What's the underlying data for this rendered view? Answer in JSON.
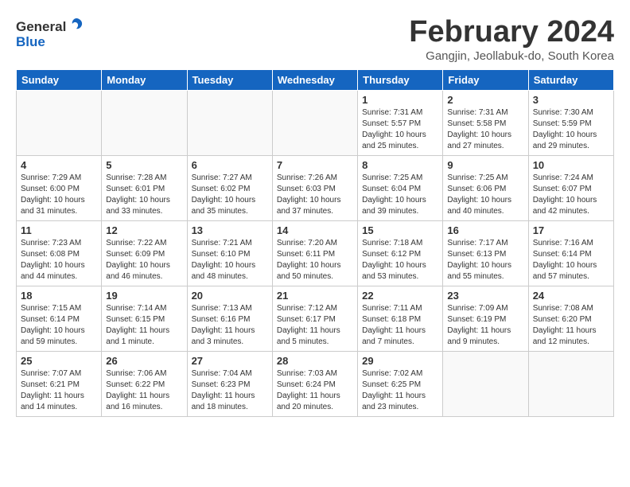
{
  "header": {
    "logo_general": "General",
    "logo_blue": "Blue",
    "title": "February 2024",
    "location": "Gangjin, Jeollabuk-do, South Korea"
  },
  "weekdays": [
    "Sunday",
    "Monday",
    "Tuesday",
    "Wednesday",
    "Thursday",
    "Friday",
    "Saturday"
  ],
  "weeks": [
    [
      {
        "day": "",
        "info": ""
      },
      {
        "day": "",
        "info": ""
      },
      {
        "day": "",
        "info": ""
      },
      {
        "day": "",
        "info": ""
      },
      {
        "day": "1",
        "info": "Sunrise: 7:31 AM\nSunset: 5:57 PM\nDaylight: 10 hours\nand 25 minutes."
      },
      {
        "day": "2",
        "info": "Sunrise: 7:31 AM\nSunset: 5:58 PM\nDaylight: 10 hours\nand 27 minutes."
      },
      {
        "day": "3",
        "info": "Sunrise: 7:30 AM\nSunset: 5:59 PM\nDaylight: 10 hours\nand 29 minutes."
      }
    ],
    [
      {
        "day": "4",
        "info": "Sunrise: 7:29 AM\nSunset: 6:00 PM\nDaylight: 10 hours\nand 31 minutes."
      },
      {
        "day": "5",
        "info": "Sunrise: 7:28 AM\nSunset: 6:01 PM\nDaylight: 10 hours\nand 33 minutes."
      },
      {
        "day": "6",
        "info": "Sunrise: 7:27 AM\nSunset: 6:02 PM\nDaylight: 10 hours\nand 35 minutes."
      },
      {
        "day": "7",
        "info": "Sunrise: 7:26 AM\nSunset: 6:03 PM\nDaylight: 10 hours\nand 37 minutes."
      },
      {
        "day": "8",
        "info": "Sunrise: 7:25 AM\nSunset: 6:04 PM\nDaylight: 10 hours\nand 39 minutes."
      },
      {
        "day": "9",
        "info": "Sunrise: 7:25 AM\nSunset: 6:06 PM\nDaylight: 10 hours\nand 40 minutes."
      },
      {
        "day": "10",
        "info": "Sunrise: 7:24 AM\nSunset: 6:07 PM\nDaylight: 10 hours\nand 42 minutes."
      }
    ],
    [
      {
        "day": "11",
        "info": "Sunrise: 7:23 AM\nSunset: 6:08 PM\nDaylight: 10 hours\nand 44 minutes."
      },
      {
        "day": "12",
        "info": "Sunrise: 7:22 AM\nSunset: 6:09 PM\nDaylight: 10 hours\nand 46 minutes."
      },
      {
        "day": "13",
        "info": "Sunrise: 7:21 AM\nSunset: 6:10 PM\nDaylight: 10 hours\nand 48 minutes."
      },
      {
        "day": "14",
        "info": "Sunrise: 7:20 AM\nSunset: 6:11 PM\nDaylight: 10 hours\nand 50 minutes."
      },
      {
        "day": "15",
        "info": "Sunrise: 7:18 AM\nSunset: 6:12 PM\nDaylight: 10 hours\nand 53 minutes."
      },
      {
        "day": "16",
        "info": "Sunrise: 7:17 AM\nSunset: 6:13 PM\nDaylight: 10 hours\nand 55 minutes."
      },
      {
        "day": "17",
        "info": "Sunrise: 7:16 AM\nSunset: 6:14 PM\nDaylight: 10 hours\nand 57 minutes."
      }
    ],
    [
      {
        "day": "18",
        "info": "Sunrise: 7:15 AM\nSunset: 6:14 PM\nDaylight: 10 hours\nand 59 minutes."
      },
      {
        "day": "19",
        "info": "Sunrise: 7:14 AM\nSunset: 6:15 PM\nDaylight: 11 hours\nand 1 minute."
      },
      {
        "day": "20",
        "info": "Sunrise: 7:13 AM\nSunset: 6:16 PM\nDaylight: 11 hours\nand 3 minutes."
      },
      {
        "day": "21",
        "info": "Sunrise: 7:12 AM\nSunset: 6:17 PM\nDaylight: 11 hours\nand 5 minutes."
      },
      {
        "day": "22",
        "info": "Sunrise: 7:11 AM\nSunset: 6:18 PM\nDaylight: 11 hours\nand 7 minutes."
      },
      {
        "day": "23",
        "info": "Sunrise: 7:09 AM\nSunset: 6:19 PM\nDaylight: 11 hours\nand 9 minutes."
      },
      {
        "day": "24",
        "info": "Sunrise: 7:08 AM\nSunset: 6:20 PM\nDaylight: 11 hours\nand 12 minutes."
      }
    ],
    [
      {
        "day": "25",
        "info": "Sunrise: 7:07 AM\nSunset: 6:21 PM\nDaylight: 11 hours\nand 14 minutes."
      },
      {
        "day": "26",
        "info": "Sunrise: 7:06 AM\nSunset: 6:22 PM\nDaylight: 11 hours\nand 16 minutes."
      },
      {
        "day": "27",
        "info": "Sunrise: 7:04 AM\nSunset: 6:23 PM\nDaylight: 11 hours\nand 18 minutes."
      },
      {
        "day": "28",
        "info": "Sunrise: 7:03 AM\nSunset: 6:24 PM\nDaylight: 11 hours\nand 20 minutes."
      },
      {
        "day": "29",
        "info": "Sunrise: 7:02 AM\nSunset: 6:25 PM\nDaylight: 11 hours\nand 23 minutes."
      },
      {
        "day": "",
        "info": ""
      },
      {
        "day": "",
        "info": ""
      }
    ]
  ]
}
